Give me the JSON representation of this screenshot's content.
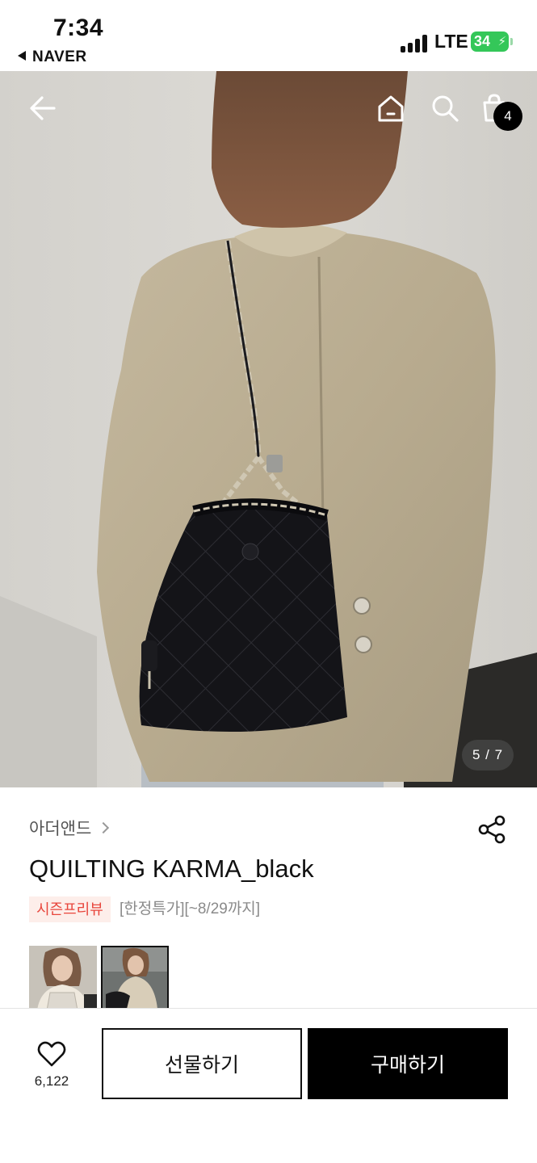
{
  "status_bar": {
    "time": "7:34",
    "back_app": "NAVER",
    "network": "LTE",
    "battery": "34"
  },
  "top_nav": {
    "back_icon": "arrow-left-icon",
    "home_icon": "home-icon",
    "search_icon": "search-icon",
    "cart_icon": "shopping-bag-icon",
    "cart_count": "4"
  },
  "gallery": {
    "counter": "5 / 7"
  },
  "product": {
    "brand": "아더앤드",
    "name": "QUILTING KARMA_black",
    "badge": "시즌프리뷰",
    "promo": "[한정특가][~8/29까지]",
    "share_icon": "share-icon"
  },
  "actions": {
    "like_icon": "heart-icon",
    "like_count": "6,122",
    "gift_label": "선물하기",
    "buy_label": "구매하기"
  },
  "colors": {
    "accent_red": "#e8463c",
    "badge_bg": "#fdeeea",
    "battery_green": "#34c759",
    "primary_black": "#000000"
  }
}
